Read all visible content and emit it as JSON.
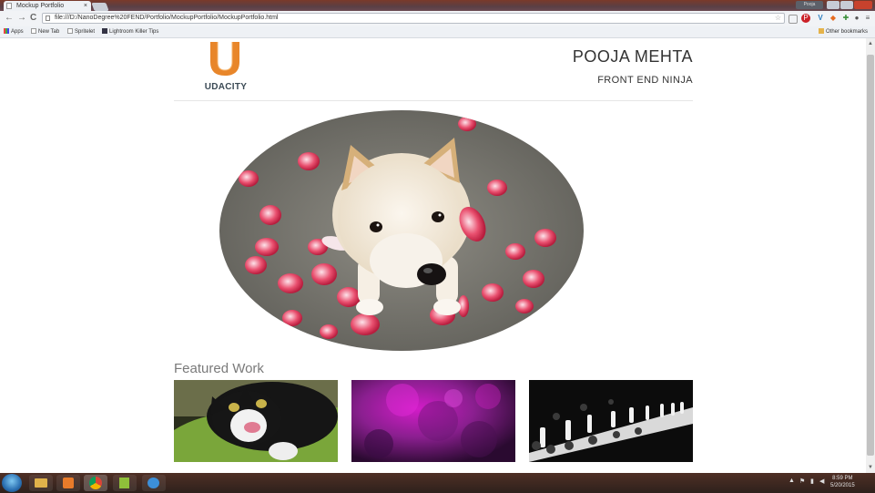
{
  "browser": {
    "tab_title": "Mockup Portfolio",
    "tab_close": "×",
    "user_badge": "Pooja",
    "url": "file:///D:/NanoDegree%20FEND/Portfolio/MockupPortfolio/MockupPortfolio.html",
    "back": "←",
    "forward": "→",
    "reload": "C",
    "bookmarks": {
      "apps": "Apps",
      "new_tab": "New Tab",
      "spritelet": "Spritelet",
      "lightroom": "Lightroom Killer Tips",
      "other": "Other bookmarks"
    }
  },
  "page": {
    "logo_text": "UDACITY",
    "name": "POOJA MEHTA",
    "subtitle": "FRONT END NINJA",
    "featured_heading": "Featured Work",
    "thumbs": [
      {
        "alt": "cat"
      },
      {
        "alt": "purple abstract"
      },
      {
        "alt": "runway"
      }
    ]
  },
  "taskbar": {
    "time": "8:59 PM",
    "date": "5/20/2015"
  },
  "colors": {
    "accent_orange": "#e8862a",
    "logo_text": "#3b4a55",
    "purple": "#8a1f8f"
  }
}
